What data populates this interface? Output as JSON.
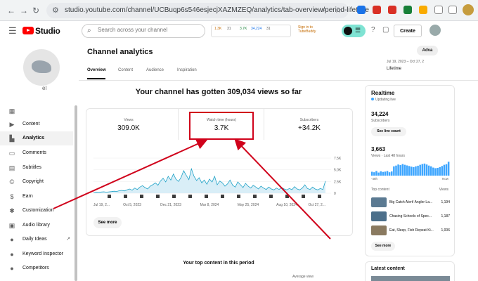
{
  "browser": {
    "url": "studio.youtube.com/channel/UCBuqp6s546esjecjXAZMZEQ/analytics/tab-overview/period-lifetime",
    "nav": {
      "back": "←",
      "forward": "→",
      "reload": "↻"
    }
  },
  "header": {
    "logo_text": "Studio",
    "search_placeholder": "Search across your channel",
    "ext_stats": [
      "1.3K",
      "31",
      "3.7K",
      "34,224",
      "31"
    ],
    "signin_line1": "Sign in to",
    "signin_line2": "TubeBuddy",
    "pill_glyph": "☰",
    "create_label": "Create"
  },
  "sidebar": {
    "channel_name": "el",
    "items": [
      {
        "label": "",
        "icon": "dashboard-icon"
      },
      {
        "label": "Content",
        "icon": "content-icon"
      },
      {
        "label": "Analytics",
        "icon": "analytics-icon",
        "active": true
      },
      {
        "label": "Comments",
        "icon": "comments-icon"
      },
      {
        "label": "Subtitles",
        "icon": "subtitles-icon"
      },
      {
        "label": "Copyright",
        "icon": "copyright-icon"
      },
      {
        "label": "Earn",
        "icon": "earn-icon"
      },
      {
        "label": "Customization",
        "icon": "customization-icon"
      },
      {
        "label": "Audio library",
        "icon": "audio-library-icon"
      },
      {
        "label": "Daily Ideas",
        "icon": "daily-ideas-icon"
      },
      {
        "label": "Keyword Inspector",
        "icon": "keyword-icon"
      },
      {
        "label": "Competitors",
        "icon": "competitors-icon"
      }
    ]
  },
  "main": {
    "title": "Channel analytics",
    "tabs": [
      "Overview",
      "Content",
      "Audience",
      "Inspiration"
    ],
    "advanced_label": "Adva",
    "date_range": "Jul 19, 2023 – Oct 27, 2",
    "date_label": "Lifetime",
    "headline": "Your channel has gotten 309,034 views so far",
    "metrics": [
      {
        "label": "Views",
        "value": "309.0K"
      },
      {
        "label": "Watch time (hours)",
        "value": "3.7K"
      },
      {
        "label": "Subscribers",
        "value": "+34.2K"
      }
    ],
    "see_more": "See more",
    "top_content_title": "Your top content in this period",
    "average_view": "Average view"
  },
  "realtime": {
    "title": "Realtime",
    "updating": "Updating live",
    "subscribers_value": "34,224",
    "subscribers_label": "Subscribers",
    "see_live": "See live count",
    "views_value": "3,663",
    "views_label": "Views · Last 48 hours",
    "axis_left": "-48h",
    "axis_right": "Now",
    "top_content_label": "Top content",
    "views_col": "Views",
    "rows": [
      {
        "title": "Big Catch Alert! Angler La...",
        "views": "1,194"
      },
      {
        "title": "Chasing Schools of Spec...",
        "views": "1,187"
      },
      {
        "title": "Eat, Sleep, Fish Repeat Ki...",
        "views": "1,006"
      }
    ],
    "see_more": "See more",
    "bars": [
      0.25,
      0.22,
      0.3,
      0.2,
      0.28,
      0.24,
      0.26,
      0.3,
      0.22,
      0.27,
      0.6,
      0.65,
      0.72,
      0.68,
      0.75,
      0.7,
      0.66,
      0.62,
      0.58,
      0.55,
      0.6,
      0.64,
      0.7,
      0.75,
      0.78,
      0.72,
      0.65,
      0.6,
      0.52,
      0.48,
      0.5,
      0.55,
      0.62,
      0.7,
      0.74,
      0.9
    ]
  },
  "latest": {
    "title": "Latest content"
  },
  "chart_data": {
    "type": "line",
    "x_tick_labels": [
      "Jul 19, 2...",
      "Oct 5, 2023",
      "Dec 21, 2023",
      "Mar 8, 2024",
      "May 25, 2024",
      "Aug 10, 2024",
      "Oct 27, 2..."
    ],
    "y_tick_labels": [
      "7.5K",
      "5.0K",
      "2.5K",
      "0"
    ],
    "ylim": [
      0,
      7500
    ],
    "series": [
      {
        "values": [
          150,
          200,
          180,
          260,
          300,
          220,
          280,
          350,
          420,
          380,
          520,
          600,
          480,
          700,
          900,
          650,
          1100,
          800,
          1300,
          1600,
          1200,
          900,
          1500,
          1800,
          2200,
          1700,
          2600,
          3200,
          2400,
          3600,
          2800,
          4100,
          3000,
          2500,
          3400,
          4800,
          3800,
          2900,
          5200,
          3600,
          2700,
          3300,
          2200,
          2800,
          1900,
          3000,
          2400,
          3600,
          1800,
          2600,
          2200,
          1500,
          2000,
          2800,
          1700,
          1300,
          2400,
          1800,
          1200,
          2100,
          1500,
          1100,
          1700,
          1300,
          900,
          1500,
          1100,
          800,
          1300,
          900,
          700,
          1100,
          800,
          1200,
          900,
          700,
          1000,
          750,
          1400,
          900,
          700,
          1100,
          1800,
          1000,
          800,
          1300,
          900,
          700,
          1000,
          800,
          2600
        ]
      }
    ]
  }
}
